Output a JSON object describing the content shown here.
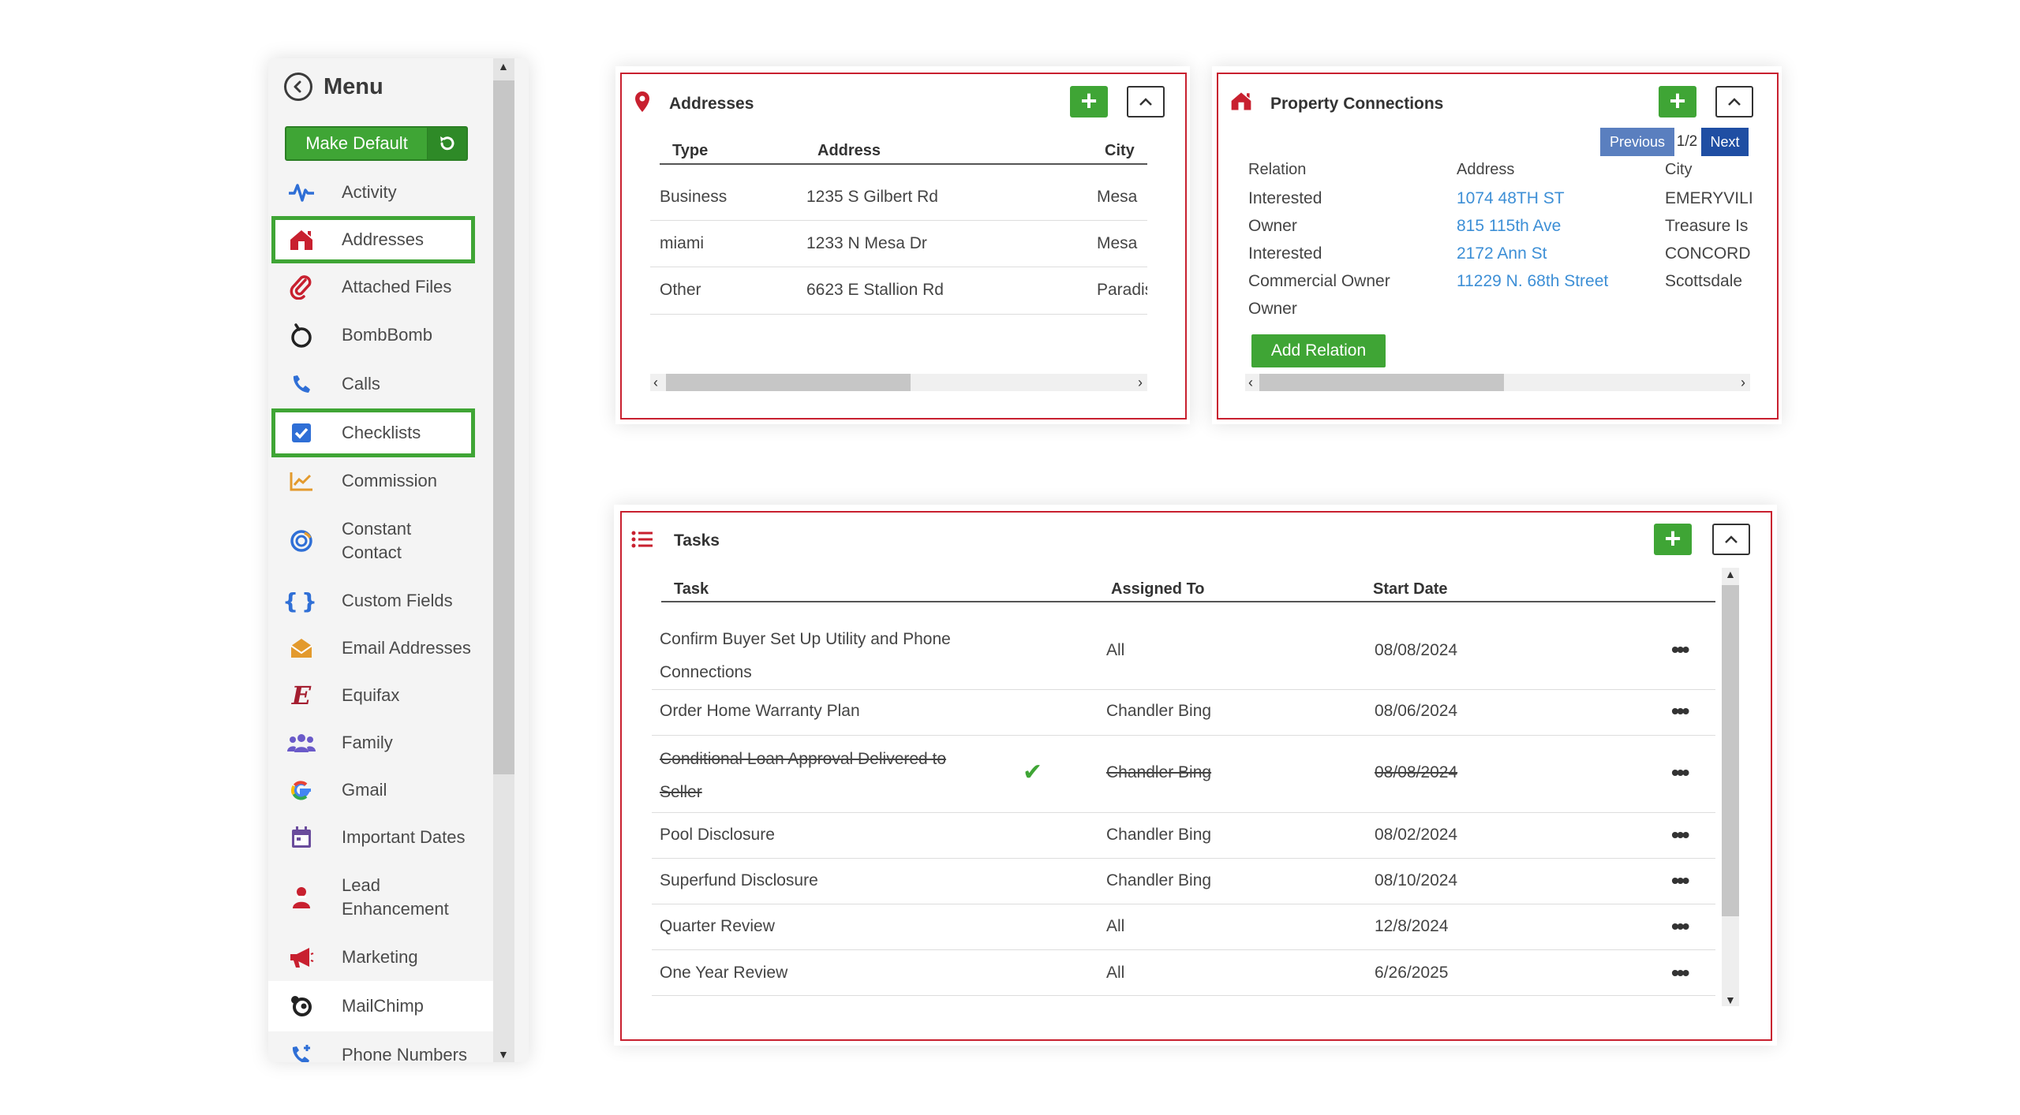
{
  "sidebar": {
    "title": "Menu",
    "make_default_label": "Make Default",
    "items": [
      {
        "label": "Activity"
      },
      {
        "label": "Addresses"
      },
      {
        "label": "Attached Files"
      },
      {
        "label": "BombBomb"
      },
      {
        "label": "Calls"
      },
      {
        "label": "Checklists"
      },
      {
        "label": "Commission"
      },
      {
        "label": "Constant Contact"
      },
      {
        "label": "Custom Fields"
      },
      {
        "label": "Email Addresses"
      },
      {
        "label": "Equifax"
      },
      {
        "label": "Family"
      },
      {
        "label": "Gmail"
      },
      {
        "label": "Important Dates"
      },
      {
        "label": "Lead Enhancement"
      },
      {
        "label": "Marketing"
      },
      {
        "label": "MailChimp"
      },
      {
        "label": "Phone Numbers"
      }
    ]
  },
  "addresses": {
    "title": "Addresses",
    "columns": [
      "Type",
      "Address",
      "City"
    ],
    "rows": [
      {
        "type": "Business",
        "address": "1235 S Gilbert Rd",
        "city": "Mesa"
      },
      {
        "type": "miami",
        "address": "1233 N Mesa Dr",
        "city": "Mesa"
      },
      {
        "type": "Other",
        "address": "6623 E Stallion Rd",
        "city": "Paradis"
      }
    ]
  },
  "property": {
    "title": "Property Connections",
    "pager": {
      "previous": "Previous",
      "page": "1/2",
      "next": "Next"
    },
    "columns": [
      "Relation",
      "Address",
      "City"
    ],
    "rows": [
      {
        "relation": "Interested",
        "address": "1074 48TH ST",
        "city": "EMERYVILI"
      },
      {
        "relation": "Owner",
        "address": "815 115th Ave",
        "city": "Treasure Is"
      },
      {
        "relation": "Interested",
        "address": "2172 Ann St",
        "city": "CONCORD"
      },
      {
        "relation": "Commercial Owner",
        "address": "11229 N. 68th Street",
        "city": "Scottsdale"
      },
      {
        "relation": "Owner",
        "address": "",
        "city": ""
      }
    ],
    "add_relation_label": "Add Relation"
  },
  "tasks": {
    "title": "Tasks",
    "columns": [
      "Task",
      "Assigned To",
      "Start Date"
    ],
    "rows": [
      {
        "task_line1": "Confirm Buyer Set Up Utility and Phone",
        "task_line2": "Connections",
        "assigned": "All",
        "date": "08/08/2024",
        "done": false
      },
      {
        "task_line1": "Order Home Warranty Plan",
        "task_line2": "",
        "assigned": "Chandler Bing",
        "date": "08/06/2024",
        "done": false
      },
      {
        "task_line1": "Conditional Loan Approval Delivered to",
        "task_line2": "Seller",
        "assigned": "Chandler Bing",
        "date": "08/08/2024",
        "done": true
      },
      {
        "task_line1": "Pool Disclosure",
        "task_line2": "",
        "assigned": "Chandler Bing",
        "date": "08/02/2024",
        "done": false
      },
      {
        "task_line1": "Superfund Disclosure",
        "task_line2": "",
        "assigned": "Chandler Bing",
        "date": "08/10/2024",
        "done": false
      },
      {
        "task_line1": "Quarter Review",
        "task_line2": "",
        "assigned": "All",
        "date": "12/8/2024",
        "done": false
      },
      {
        "task_line1": "One Year Review",
        "task_line2": "",
        "assigned": "All",
        "date": "6/26/2025",
        "done": false
      }
    ],
    "row_menu_glyph": "•••",
    "check_glyph": "✔"
  },
  "icons": {
    "add": "+",
    "left_arrow": "‹",
    "right_arrow": "›"
  },
  "colors": {
    "accent_green": "#3fa535",
    "border_red": "#c8202f",
    "link_blue": "#3d8fd6",
    "pager_previous": "#5a7fbf",
    "pager_next": "#1f4ea3"
  }
}
